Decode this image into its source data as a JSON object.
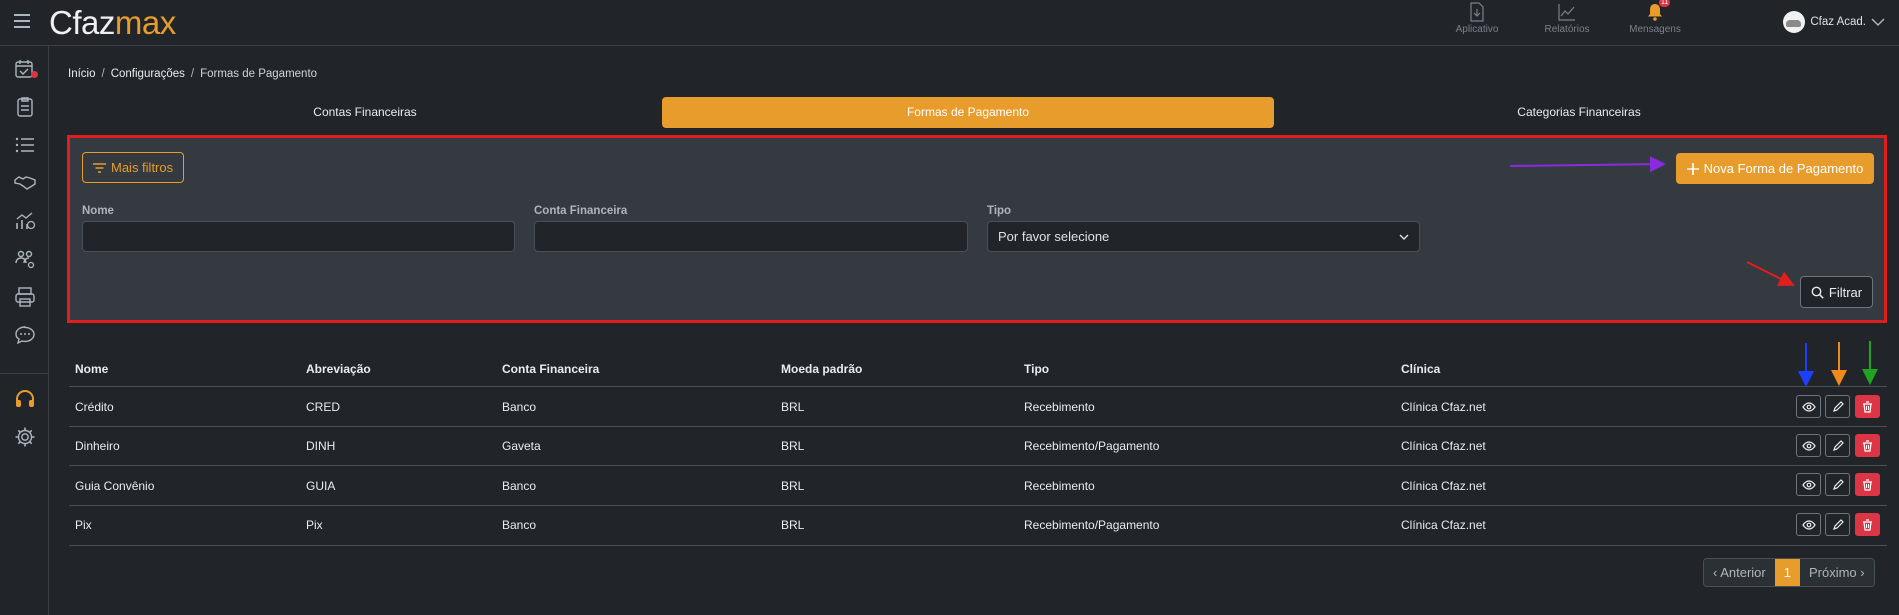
{
  "app": {
    "logo_part1": "Cfaz",
    "logo_part2": "max"
  },
  "topbar": {
    "actions": [
      {
        "label": "Aplicativo",
        "icon": "download-icon"
      },
      {
        "label": "Relatórios",
        "icon": "chart-icon"
      },
      {
        "label": "Mensagens",
        "icon": "bell-icon",
        "badge": "11"
      }
    ],
    "user_name": "Cfaz Acad."
  },
  "breadcrumb": [
    "Início",
    "Configurações",
    "Formas de Pagamento"
  ],
  "tabs": [
    "Contas Financeiras",
    "Formas de Pagamento",
    "Categorias Financeiras"
  ],
  "filters": {
    "more_filters": "Mais filtros",
    "new_button": "Nova Forma de Pagamento",
    "nome_label": "Nome",
    "conta_label": "Conta Financeira",
    "tipo_label": "Tipo",
    "tipo_value": "Por favor selecione",
    "filter_button": "Filtrar"
  },
  "table": {
    "headers": [
      "Nome",
      "Abreviação",
      "Conta Financeira",
      "Moeda padrão",
      "Tipo",
      "Clínica"
    ],
    "rows": [
      [
        "Crédito",
        "CRED",
        "Banco",
        "BRL",
        "Recebimento",
        "Clínica Cfaz.net"
      ],
      [
        "Dinheiro",
        "DINH",
        "Gaveta",
        "BRL",
        "Recebimento/Pagamento",
        "Clínica Cfaz.net"
      ],
      [
        "Guia Convênio",
        "GUIA",
        "Banco",
        "BRL",
        "Recebimento",
        "Clínica Cfaz.net"
      ],
      [
        "Pix",
        "Pix",
        "Banco",
        "BRL",
        "Recebimento/Pagamento",
        "Clínica Cfaz.net"
      ]
    ]
  },
  "pagination": {
    "prev": "‹ Anterior",
    "current": "1",
    "next": "Próximo ›"
  },
  "colors": {
    "accent": "#e89c2c",
    "danger": "#dc3545",
    "highlight_border": "#e01e1e"
  }
}
